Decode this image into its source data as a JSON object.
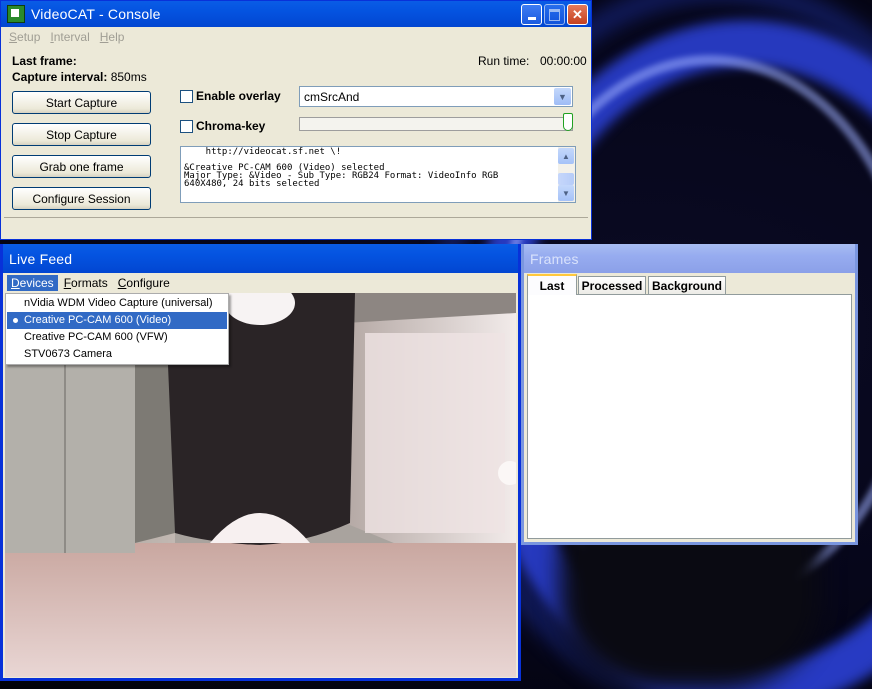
{
  "console": {
    "title": "VideoCAT - Console",
    "menu": [
      "Setup",
      "Interval",
      "Help"
    ],
    "last_frame_label": "Last frame:",
    "capture_interval_label": "Capture interval:",
    "capture_interval_value": "850ms",
    "run_time_label": "Run time:",
    "run_time_value": "00:00:00",
    "buttons": {
      "start": "Start Capture",
      "stop": "Stop Capture",
      "grab": "Grab one frame",
      "configure": "Configure Session"
    },
    "enable_overlay_label": "Enable overlay",
    "enable_overlay_checked": false,
    "overlay_mode": "cmSrcAnd",
    "chroma_key_label": "Chroma-key",
    "chroma_key_checked": false,
    "chroma_slider_value": 1.0,
    "log": "    http://videocat.sf.net \\!\n\n&Creative PC-CAM 600 (Video) selected\nMajor Type: &Video - Sub Type: RGB24 Format: VideoInfo RGB\n640X480, 24 bits selected"
  },
  "live_feed": {
    "title": "Live Feed",
    "menu": [
      "Devices",
      "Formats",
      "Configure"
    ],
    "devices": [
      {
        "label": "nVidia WDM Video Capture (universal)",
        "selected": false
      },
      {
        "label": "Creative PC-CAM 600 (Video)",
        "selected": true
      },
      {
        "label": "Creative PC-CAM 600 (VFW)",
        "selected": false
      },
      {
        "label": "STV0673 Camera",
        "selected": false
      }
    ]
  },
  "frames": {
    "title": "Frames",
    "tabs": [
      "Last",
      "Processed",
      "Background"
    ],
    "active_tab": "Last"
  },
  "colors": {
    "xp_titlebar": "#0453e0",
    "window_face": "#ece9d8",
    "selection": "#316ac5"
  }
}
